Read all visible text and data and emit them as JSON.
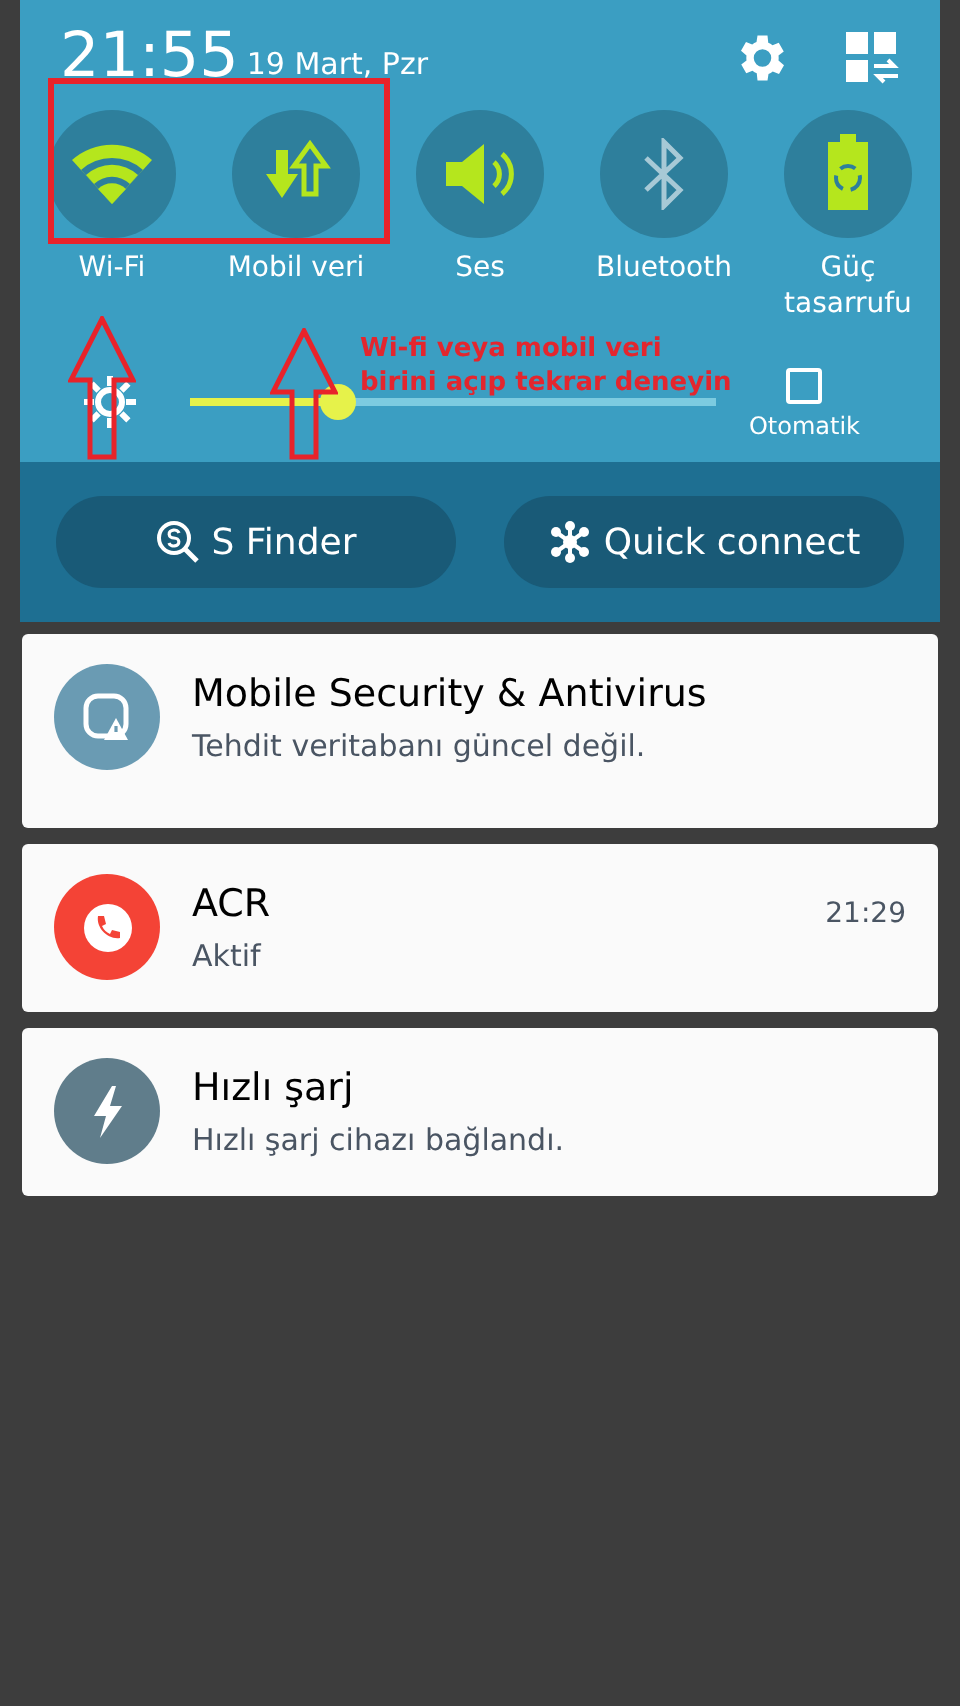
{
  "status": {
    "time": "21:55",
    "date": "19 Mart, Pzr"
  },
  "quick_settings": [
    {
      "kind": "wifi",
      "label": "Wi-Fi",
      "on": true
    },
    {
      "kind": "data",
      "label": "Mobil veri",
      "on": true
    },
    {
      "kind": "sound",
      "label": "Ses",
      "on": true
    },
    {
      "kind": "bluetooth",
      "label": "Bluetooth",
      "on": false
    },
    {
      "kind": "battery",
      "label": "Güç tasarrufu",
      "on": true
    }
  ],
  "brightness": {
    "level": 0.28,
    "auto_label": "Otomatik",
    "auto_checked": false
  },
  "buttons": [
    {
      "kind": "finder",
      "label": "S Finder"
    },
    {
      "kind": "connect",
      "label": "Quick connect"
    }
  ],
  "notifications": [
    {
      "kind": "shield",
      "title": "Mobile Security & Antivirus",
      "text": "Tehdit veritabanı güncel değil.",
      "color": "#6a9bb3"
    },
    {
      "kind": "phone",
      "title": "ACR",
      "text": "Aktif",
      "time": "21:29",
      "color": "#f44336"
    },
    {
      "kind": "bolt",
      "title": "Hızlı şarj",
      "text": "Hızlı şarj cihazı bağlandı.",
      "color": "#607d8b"
    }
  ],
  "annotation": {
    "lines": [
      "Wi-fi veya mobil veri",
      "birini açıp tekrar deneyin"
    ]
  }
}
